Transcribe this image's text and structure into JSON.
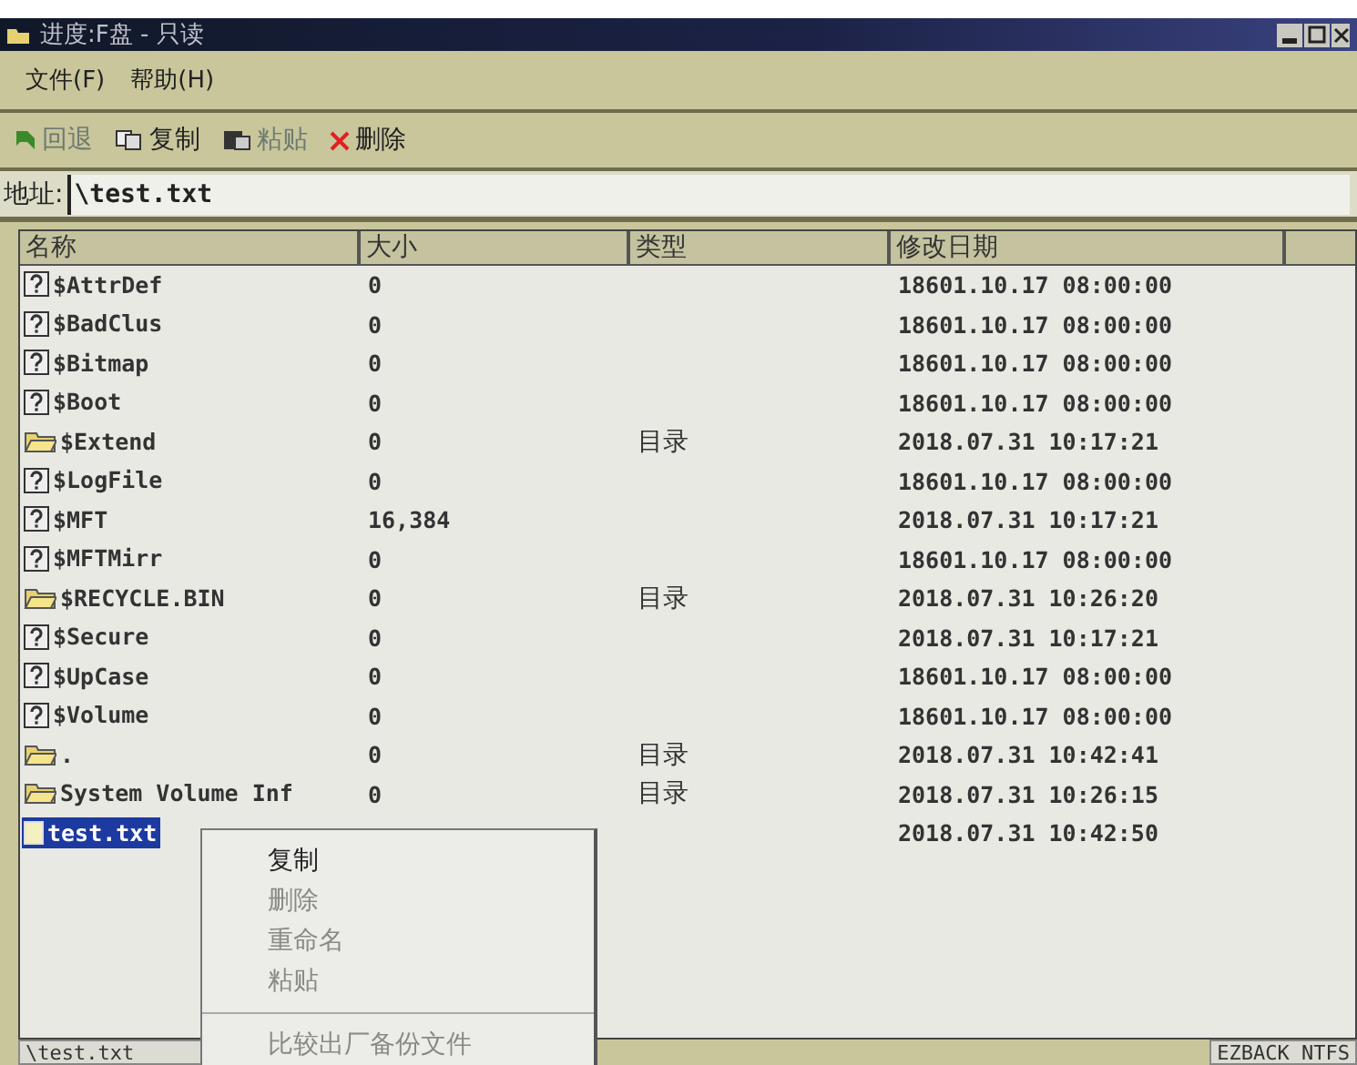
{
  "window": {
    "title": "进度:F盘 - 只读"
  },
  "menu_bar": [
    "文件(F)",
    "帮助(H)"
  ],
  "toolbar": [
    {
      "kind": "back",
      "label": "回退",
      "disabled": true
    },
    {
      "kind": "copy",
      "label": "复制",
      "disabled": false
    },
    {
      "kind": "paste",
      "label": "粘贴",
      "disabled": true
    },
    {
      "kind": "delete",
      "label": "删除",
      "disabled": false
    }
  ],
  "address": {
    "label": "地址:",
    "value": "\\test.txt"
  },
  "table": {
    "columns": [
      "名称",
      "大小",
      "类型",
      "修改日期"
    ],
    "rows": [
      {
        "kind": "unknown",
        "name": "$AttrDef",
        "size": "0",
        "type": "",
        "date": "18601.10.17 08:00:00",
        "selected": false
      },
      {
        "kind": "unknown",
        "name": "$BadClus",
        "size": "0",
        "type": "",
        "date": "18601.10.17 08:00:00",
        "selected": false
      },
      {
        "kind": "unknown",
        "name": "$Bitmap",
        "size": "0",
        "type": "",
        "date": "18601.10.17 08:00:00",
        "selected": false
      },
      {
        "kind": "unknown",
        "name": "$Boot",
        "size": "0",
        "type": "",
        "date": "18601.10.17 08:00:00",
        "selected": false
      },
      {
        "kind": "folder",
        "name": "$Extend",
        "size": "0",
        "type": "目录",
        "date": "2018.07.31 10:17:21",
        "selected": false
      },
      {
        "kind": "unknown",
        "name": "$LogFile",
        "size": "0",
        "type": "",
        "date": "18601.10.17 08:00:00",
        "selected": false
      },
      {
        "kind": "unknown",
        "name": "$MFT",
        "size": "16,384",
        "type": "",
        "date": "2018.07.31 10:17:21",
        "selected": false
      },
      {
        "kind": "unknown",
        "name": "$MFTMirr",
        "size": "0",
        "type": "",
        "date": "18601.10.17 08:00:00",
        "selected": false
      },
      {
        "kind": "folder",
        "name": "$RECYCLE.BIN",
        "size": "0",
        "type": "目录",
        "date": "2018.07.31 10:26:20",
        "selected": false
      },
      {
        "kind": "unknown",
        "name": "$Secure",
        "size": "0",
        "type": "",
        "date": "2018.07.31 10:17:21",
        "selected": false
      },
      {
        "kind": "unknown",
        "name": "$UpCase",
        "size": "0",
        "type": "",
        "date": "18601.10.17 08:00:00",
        "selected": false
      },
      {
        "kind": "unknown",
        "name": "$Volume",
        "size": "0",
        "type": "",
        "date": "18601.10.17 08:00:00",
        "selected": false
      },
      {
        "kind": "folder",
        "name": ".",
        "size": "0",
        "type": "目录",
        "date": "2018.07.31 10:42:41",
        "selected": false
      },
      {
        "kind": "folder",
        "name": "System Volume Inf",
        "size": "0",
        "type": "目录",
        "date": "2018.07.31 10:26:15",
        "selected": false
      },
      {
        "kind": "text",
        "name": "test.txt",
        "size": "",
        "type": "",
        "date": "2018.07.31 10:42:50",
        "selected": true
      }
    ]
  },
  "context_menu": [
    {
      "label": "复制",
      "disabled": false
    },
    {
      "label": "删除",
      "disabled": true
    },
    {
      "label": "重命名",
      "disabled": true
    },
    {
      "label": "粘贴",
      "disabled": true
    },
    {
      "kind": "separator"
    },
    {
      "label": "比较出厂备份文件",
      "disabled": true
    }
  ],
  "status_bar": [
    "\\test.txt",
    "EZBACK NTFS"
  ]
}
